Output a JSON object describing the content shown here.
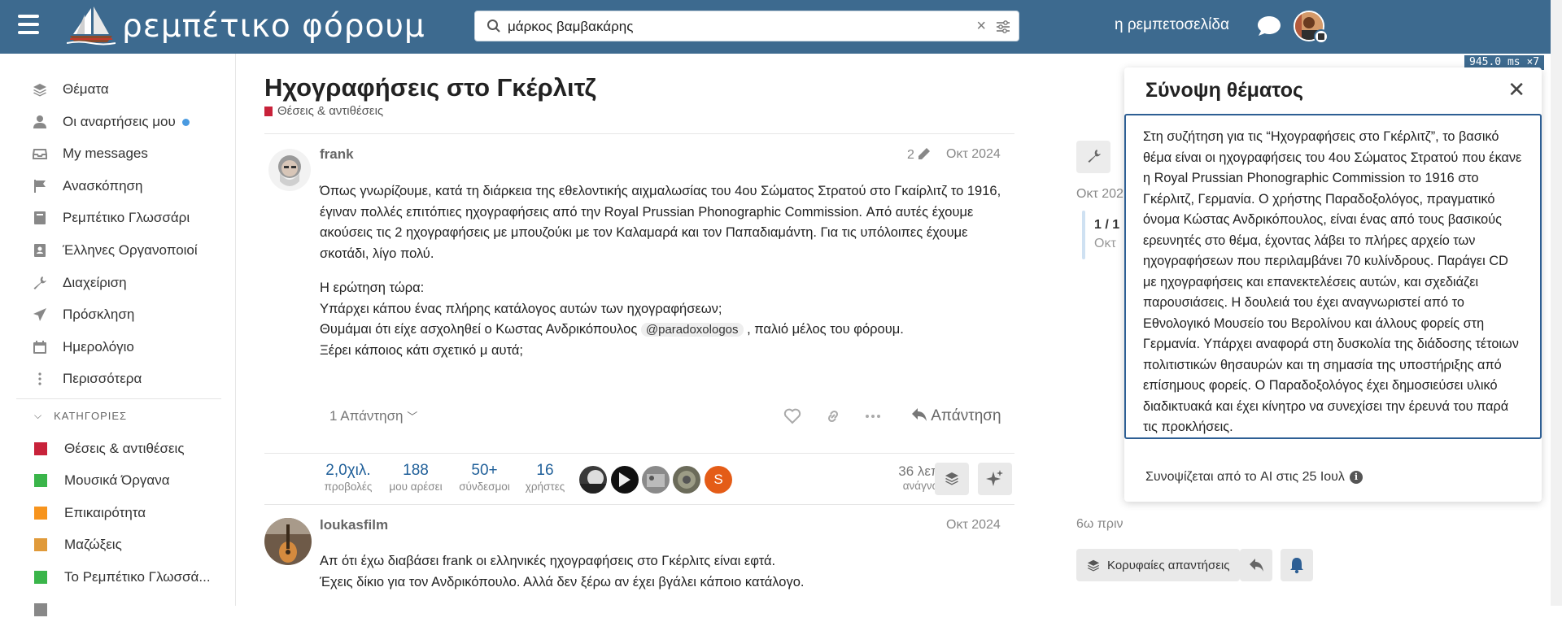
{
  "header": {
    "logo_text": "ρεμπέτικο φόρουμ",
    "search_value": "μάρκος βαμβακάρης",
    "site_link": "η ρεμπετοσελίδα",
    "timing": "945.0 ms ×7"
  },
  "sidebar": {
    "items": [
      {
        "label": "Θέματα",
        "icon": "layers-icon"
      },
      {
        "label": "Οι αναρτήσεις μου",
        "icon": "user-icon"
      },
      {
        "label": "My messages",
        "icon": "inbox-icon"
      },
      {
        "label": "Ανασκόπηση",
        "icon": "flag-icon"
      },
      {
        "label": "Ρεμπέτικο Γλωσσάρι",
        "icon": "book-icon"
      },
      {
        "label": "Έλληνες Οργανοποιοί",
        "icon": "contact-book-icon"
      },
      {
        "label": "Διαχείριση",
        "icon": "wrench-icon"
      },
      {
        "label": "Πρόσκληση",
        "icon": "paper-plane-icon"
      },
      {
        "label": "Ημερολόγιο",
        "icon": "calendar-icon"
      },
      {
        "label": "Περισσότερα",
        "icon": "ellipsis-vertical-icon"
      }
    ],
    "categories_header": "ΚΑΤΗΓΟΡΙΕΣ",
    "categories": [
      {
        "label": "Θέσεις & αντιθέσεις",
        "color": "#c8223a"
      },
      {
        "label": "Μουσικά Όργανα",
        "color": "#3ab54a"
      },
      {
        "label": "Επικαιρότητα",
        "color": "#f7941d"
      },
      {
        "label": "Μαζώξεις",
        "color": "#e09a3a"
      },
      {
        "label": "Το Ρεμπέτικο Γλωσσά...",
        "color": "#3ab54a"
      }
    ]
  },
  "topic": {
    "title": "Ηχογραφήσεις στο Γκέρλιτζ",
    "category": "Θέσεις & αντιθέσεις",
    "category_color": "#c8223a"
  },
  "post1": {
    "author": "frank",
    "edits": "2",
    "date": "Οκτ 2024",
    "p1": "Όπως γνωρίζουμε, κατά τη διάρκεια της εθελοντικής αιχμαλωσίας του 4ου Σώματος Στρατού στο Γκαίρλιτζ το 1916, έγιναν πολλές επιτόπιες ηχογραφήσεις από την Royal Prussian Phonographic Commission. Από αυτές έχουμε ακούσεις τις 2 ηχογραφήσεις με μπουζούκι με τον Καλαμαρά και τον Παπαδιαμάντη. Για τις υπόλοιπες έχουμε σκοτάδι, λίγο πολύ.",
    "l1": "Η ερώτηση τώρα:",
    "l2": "Υπάρχει κάπου ένας πλήρης κατάλογος αυτών των ηχογραφήσεων;",
    "l3_pre": "Θυμάμαι ότι είχε ασχοληθεί ο Κωστας Ανδρικόπουλος ",
    "mention": "@paradoxologos",
    "l3_post": " , παλιό μέλος του φόρουμ.",
    "l4": "Ξέρει κάποιος κάτι σχετικό μ αυτά;",
    "replies_label": "1 Απάντηση",
    "reply_label": "Απάντηση"
  },
  "stats": [
    {
      "value": "2,0χιλ.",
      "label": "προβολές"
    },
    {
      "value": "188",
      "label": "μου αρέσει"
    },
    {
      "value": "50+",
      "label": "σύνδεσμοι"
    },
    {
      "value": "16",
      "label": "χρήστες"
    }
  ],
  "participant_avatars": [
    {
      "color": "#444"
    },
    {
      "color": "#111"
    },
    {
      "color": "#8a8a8a"
    },
    {
      "color": "#6b6b5a"
    },
    {
      "color": "#e45c17",
      "letter": "S"
    }
  ],
  "read_time": {
    "value": "36 λεπτά",
    "label": "ανάγνωση"
  },
  "post2": {
    "author": "loukasfilm",
    "date": "Οκτ 2024",
    "l1": "Απ ότι έχω διαβάσει frank οι ελληνικές ηχογραφήσεις στο Γκέρλιτς είναι εφτά.",
    "l2": "Έχεις δίκιο για τον Ανδρικόπουλο. Αλλά δεν ξέρω αν έχει βγάλει κάποιο κατάλογο."
  },
  "timeline": {
    "date": "Οκτ 202",
    "position": "1 / 1",
    "sub": "Οκτ",
    "ago": "6ω πριν",
    "top_replies": "Κορυφαίες απαντήσεις"
  },
  "summary": {
    "title": "Σύνοψη θέματος",
    "text": "Στη συζήτηση για τις “Ηχογραφήσεις στο Γκέρλιτζ”, το βασικό θέμα είναι οι ηχογραφήσεις του 4ου Σώματος Στρατού που έκανε η Royal Prussian Phonographic Commission το 1916 στο Γκέρλιτζ, Γερμανία. Ο χρήστης Παραδοξολόγος, πραγματικό όνομα Κώστας Ανδρικόπουλος, είναι ένας από τους βασικούς ερευνητές στο θέμα, έχοντας λάβει το πλήρες αρχείο των ηχογραφήσεων που περιλαμβάνει 70 κυλίνδρους. Παράγει CD με ηχογραφήσεις και επανεκτελέσεις αυτών, και σχεδιάζει παρουσιάσεις. Η δουλειά του έχει αναγνωριστεί από το Εθνολογικό Μουσείο του Βερολίνου και άλλους φορείς στη Γερμανία. Υπάρχει αναφορά στη δυσκολία της διάδοσης τέτοιων πολιτιστικών θησαυρών και τη σημασία της υποστήριξης από επίσημους φορείς. Ο Παραδοξολόγος έχει δημοσιεύσει υλικό διαδικτυακά και έχει κίνητρο να συνεχίσει την έρευνά του παρά τις προκλήσεις.",
    "footer": "Συνοψίζεται από το AI στις 25 Ιουλ"
  }
}
